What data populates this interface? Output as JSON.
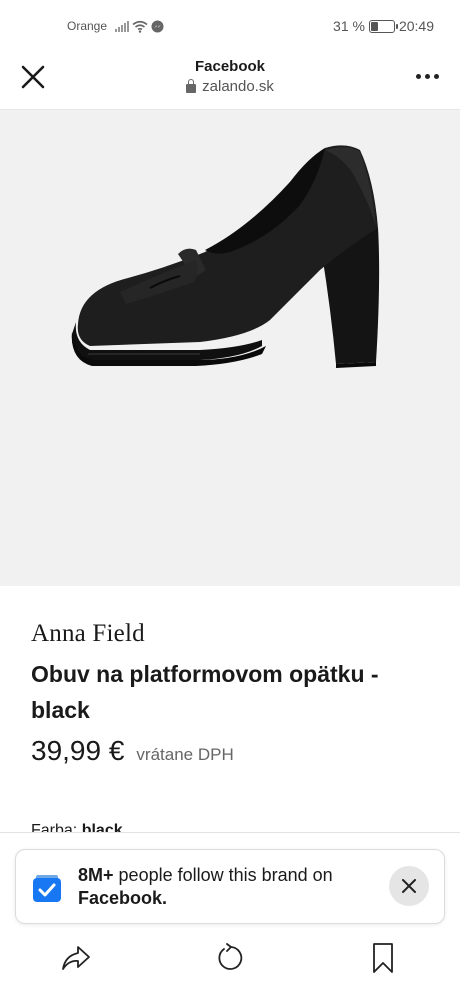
{
  "status_bar": {
    "carrier": "Orange",
    "battery": "31 %",
    "battery_level": 0.31,
    "time": "20:49"
  },
  "browser": {
    "title": "Facebook",
    "url": "zalando.sk"
  },
  "product": {
    "brand": "Anna Field",
    "name": "Obuv na platformovom opätku - black",
    "price": "39,99 €",
    "vat_note": "vrátane DPH",
    "color_label": "Farba:",
    "color_value": "black"
  },
  "follow_banner": {
    "count": "8M+",
    "text": "people follow this brand on",
    "platform": "Facebook."
  },
  "icons": [
    "close-icon",
    "more-icon",
    "lock-icon",
    "brand-follow-icon",
    "dismiss-icon",
    "share-icon",
    "reload-icon",
    "bookmark-icon"
  ]
}
